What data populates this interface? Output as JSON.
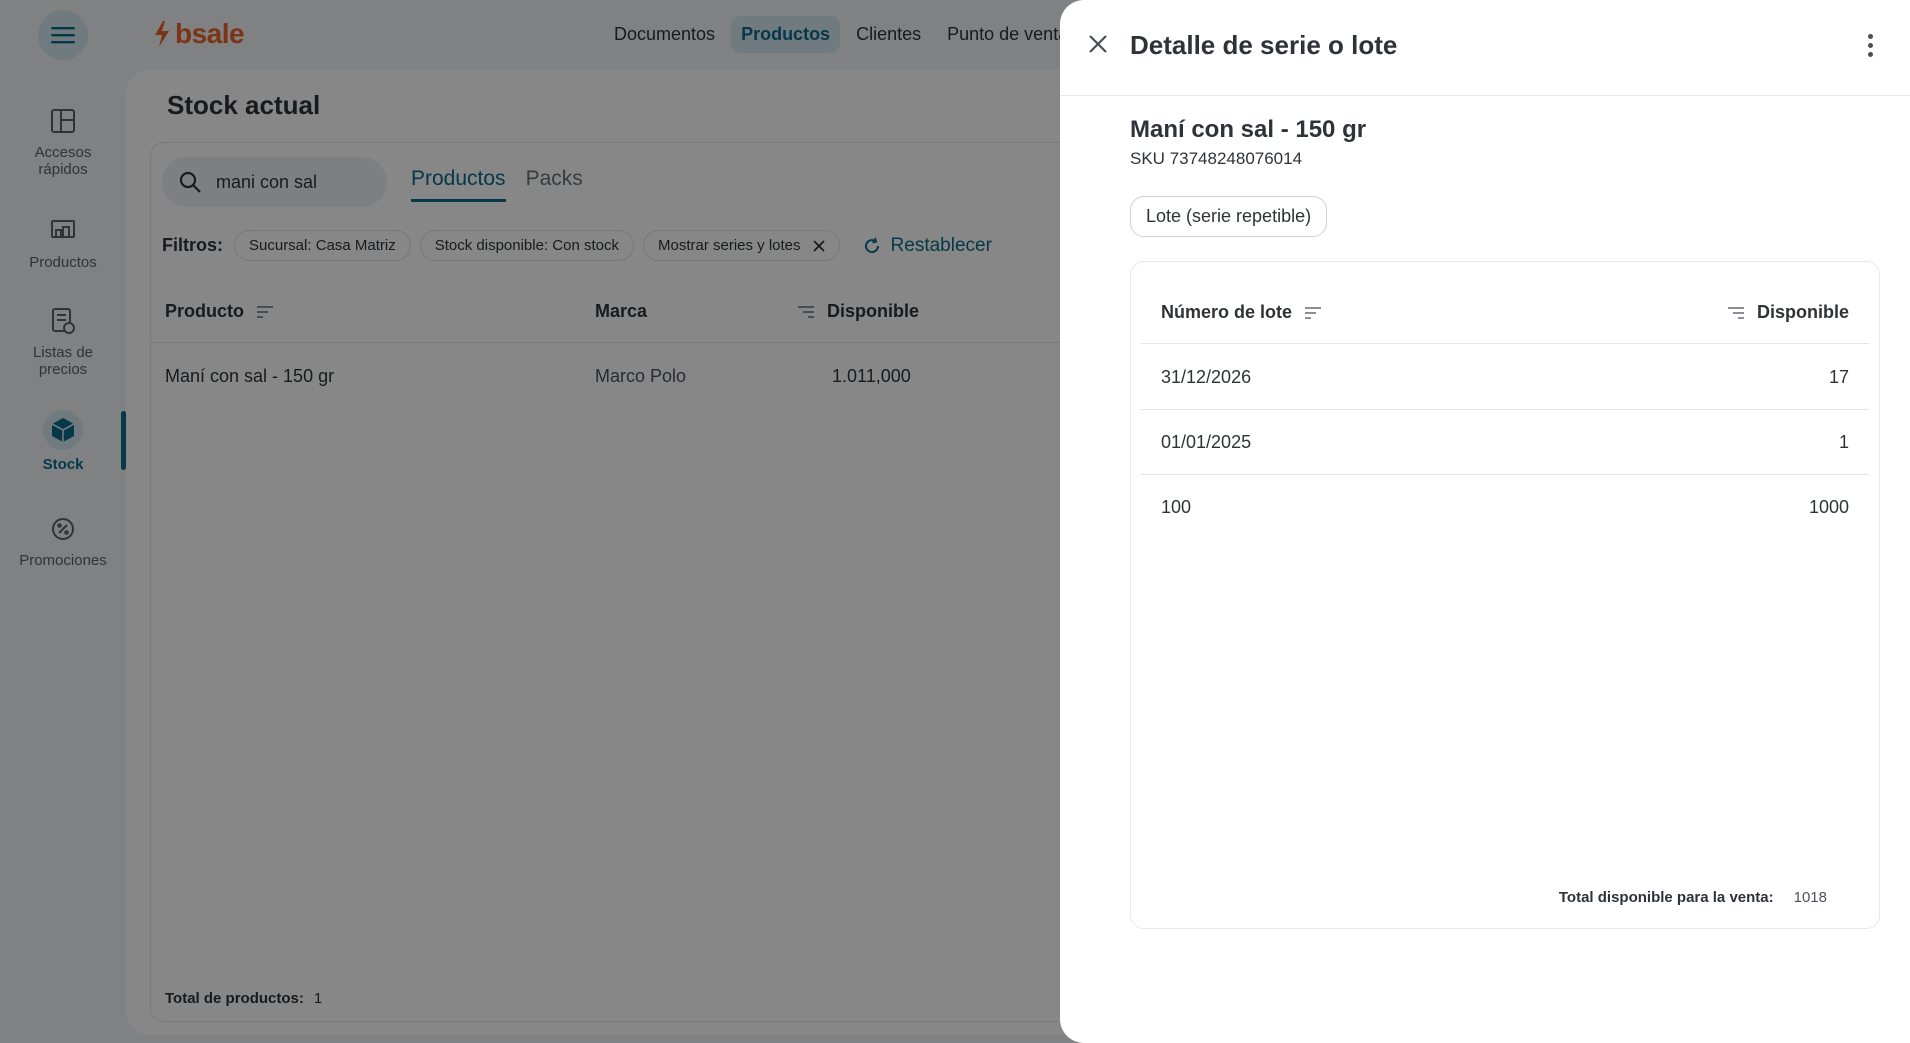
{
  "app": {
    "brand": "bsale",
    "brand_color": "#e8622a",
    "accent_color": "#0b6c8a"
  },
  "topnav": {
    "items": [
      {
        "label": "Documentos",
        "active": false
      },
      {
        "label": "Productos",
        "active": true
      },
      {
        "label": "Clientes",
        "active": false
      },
      {
        "label": "Punto de venta",
        "active": false
      }
    ]
  },
  "sidebar": {
    "items": [
      {
        "label": "Accesos rápidos",
        "icon": "layout-icon"
      },
      {
        "label": "Productos",
        "icon": "products-icon"
      },
      {
        "label": "Listas de precios",
        "icon": "price-list-icon"
      },
      {
        "label": "Stock",
        "icon": "cube-icon",
        "active": true
      },
      {
        "label": "Promociones",
        "icon": "promo-gear-icon"
      }
    ]
  },
  "stock_page": {
    "title": "Stock actual",
    "search_value": "mani con sal",
    "tabs": [
      {
        "label": "Productos",
        "active": true
      },
      {
        "label": "Packs",
        "active": false
      }
    ],
    "filters_label": "Filtros:",
    "filters": [
      "Sucursal: Casa Matriz",
      "Stock disponible: Con stock",
      "Mostrar series y lotes"
    ],
    "reset_label": "Restablecer",
    "columns": {
      "product": "Producto",
      "brand": "Marca",
      "available": "Disponible"
    },
    "rows": [
      {
        "product": "Maní con sal - 150 gr",
        "brand": "Marco Polo",
        "available": "1.011,000"
      }
    ],
    "total_label": "Total de productos:",
    "total_value": "1"
  },
  "drawer": {
    "title": "Detalle de serie o lote",
    "product_name": "Maní con sal - 150 gr",
    "sku": "SKU 73748248076014",
    "type_chip": "Lote (serie repetible)",
    "table": {
      "col_lot": "Número de lote",
      "col_available": "Disponible",
      "rows": [
        {
          "lot": "31/12/2026",
          "available": "17"
        },
        {
          "lot": "01/01/2025",
          "available": "1"
        },
        {
          "lot": "100",
          "available": "1000"
        }
      ]
    },
    "total_label": "Total disponible para la venta:",
    "total_value": "1018"
  }
}
